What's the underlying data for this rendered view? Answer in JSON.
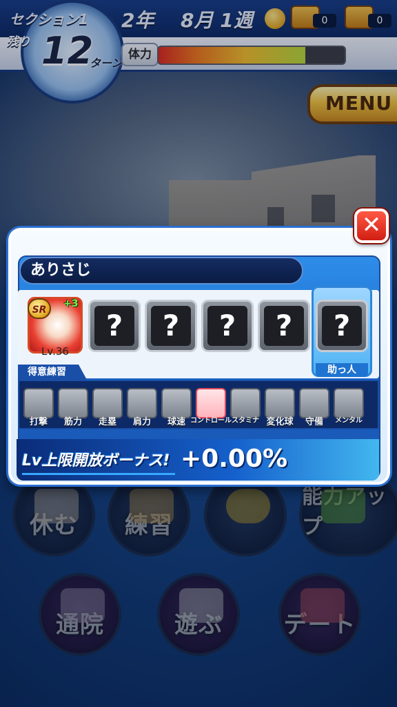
{
  "hud": {
    "section": "セクション1",
    "year": "2年",
    "month_week": "8月 1週",
    "turns_label": "残り",
    "turns_value": "12",
    "turns_unit": "ターン",
    "chest1_count": "0",
    "chest2_count": "0",
    "hp_label": "体力",
    "hp_fraction": 0.79,
    "menu_label": "MENU"
  },
  "dialog": {
    "title": "ありさじ",
    "player_card": {
      "rarity": "SR",
      "plus": "+3",
      "level": "Lv.36"
    },
    "empty_slot_glyph": "?",
    "helper_label": "助っ人",
    "skill_header": "得意練習",
    "skills": [
      {
        "label": "打撃",
        "icon": "bat-icon"
      },
      {
        "label": "筋力",
        "icon": "dumbbell-icon"
      },
      {
        "label": "走塁",
        "icon": "base-icon"
      },
      {
        "label": "肩力",
        "icon": "arm-icon"
      },
      {
        "label": "球速",
        "icon": "pitch-icon"
      },
      {
        "label": "コントロール",
        "icon": "target-icon",
        "active": true
      },
      {
        "label": "スタミナ",
        "icon": "shoe-icon"
      },
      {
        "label": "変化球",
        "icon": "breaking-ball-icon"
      },
      {
        "label": "守備",
        "icon": "glove-icon"
      },
      {
        "label": "メンタル",
        "icon": "cloud-icon"
      }
    ],
    "bonus_label": "Lv上限開放ボーナス!",
    "bonus_value": "+0.00%"
  },
  "background_buttons": {
    "rest": "休む",
    "practice": "練習",
    "ability_up": "能力アップ",
    "hospital": "通院",
    "play": "遊ぶ",
    "date": "デート"
  },
  "colors": {
    "accent_blue": "#1b63c6",
    "close_red": "#d11e13",
    "menu_gold": "#f3c33c"
  }
}
